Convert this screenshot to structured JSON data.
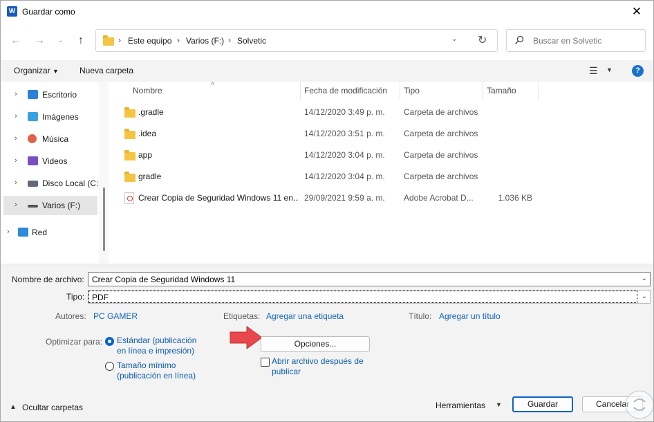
{
  "window": {
    "title": "Guardar como",
    "app_icon_letter": "W"
  },
  "address": {
    "crumbs": [
      "Este equipo",
      "Varios (F:)",
      "Solvetic"
    ]
  },
  "search": {
    "placeholder": "Buscar en Solvetic"
  },
  "toolbar": {
    "organize": "Organizar",
    "new_folder": "Nueva carpeta"
  },
  "sidebar": {
    "items": [
      {
        "label": "Escritorio",
        "icon": "desktop-icon"
      },
      {
        "label": "Imágenes",
        "icon": "pictures-icon"
      },
      {
        "label": "Música",
        "icon": "music-icon"
      },
      {
        "label": "Videos",
        "icon": "videos-icon"
      },
      {
        "label": "Disco Local (C:)",
        "icon": "local-disk-icon"
      },
      {
        "label": "Varios (F:)",
        "icon": "drive-icon",
        "selected": true
      },
      {
        "label": "Red",
        "icon": "network-icon"
      }
    ]
  },
  "file_list": {
    "columns": [
      "Nombre",
      "Fecha de modificación",
      "Tipo",
      "Tamaño"
    ],
    "rows": [
      {
        "name": ".gradle",
        "date": "14/12/2020 3:49 p. m.",
        "type": "Carpeta de archivos",
        "size": "",
        "icon": "folder-icon"
      },
      {
        "name": ".idea",
        "date": "14/12/2020 3:51 p. m.",
        "type": "Carpeta de archivos",
        "size": "",
        "icon": "folder-icon"
      },
      {
        "name": "app",
        "date": "14/12/2020 3:04 p. m.",
        "type": "Carpeta de archivos",
        "size": "",
        "icon": "folder-icon"
      },
      {
        "name": "gradle",
        "date": "14/12/2020 3:04 p. m.",
        "type": "Carpeta de archivos",
        "size": "",
        "icon": "folder-icon"
      },
      {
        "name": "Crear Copia de Seguridad Windows 11 en...",
        "date": "29/09/2021 9:59 a. m.",
        "type": "Adobe Acrobat D...",
        "size": "1.036 KB",
        "icon": "pdf-icon"
      }
    ]
  },
  "form": {
    "filename_label": "Nombre de archivo:",
    "filename_value": "Crear Copia de Seguridad Windows 11",
    "type_label": "Tipo:",
    "type_value": "PDF",
    "authors_label": "Autores:",
    "authors_value": "PC GAMER",
    "tags_label": "Etiquetas:",
    "tags_value": "Agregar una etiqueta",
    "title_label": "Título:",
    "title_value": "Agregar un título",
    "optimize_label": "Optimizar para:",
    "optimize_standard_line1": "Estándar (publicación",
    "optimize_standard_line2": "en línea e impresión)",
    "optimize_min_line1": "Tamaño mínimo",
    "optimize_min_line2": "(publicación en línea)",
    "optimize_selected": "Estándar (publicación en línea e impresión)",
    "options_button": "Opciones...",
    "open_after_line1": "Abrir archivo después de",
    "open_after_line2": "publicar",
    "open_after_checked": false
  },
  "footer": {
    "hide_folders": "Ocultar carpetas",
    "tools": "Herramientas",
    "save": "Guardar",
    "cancel": "Cancelar"
  },
  "colors": {
    "accent": "#0b63c5",
    "link": "#1565c0",
    "folder": "#f4c542",
    "arrow": "#e8474c"
  }
}
